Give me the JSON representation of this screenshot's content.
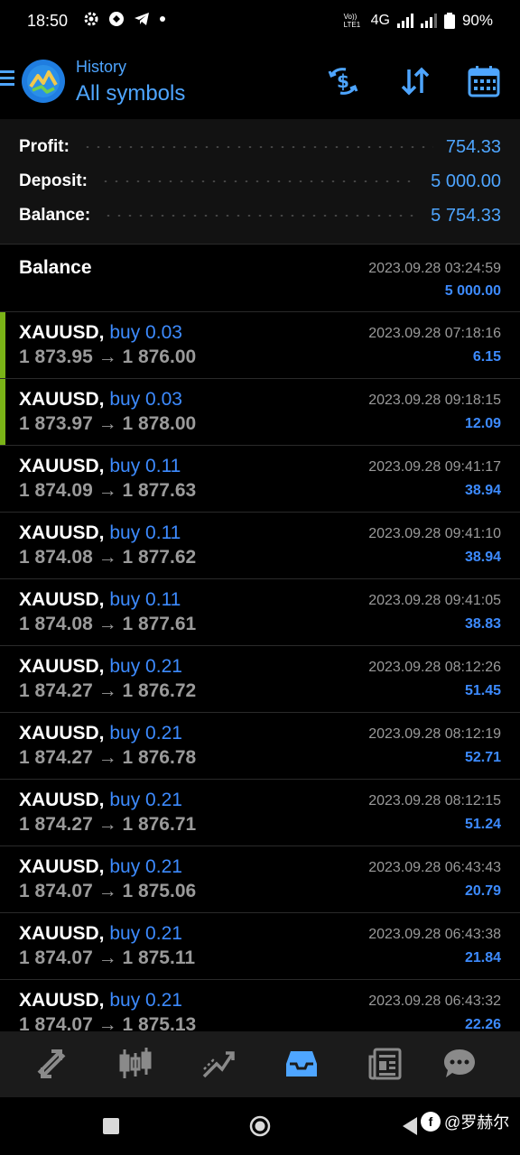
{
  "status_bar": {
    "time": "18:50",
    "network": "4G",
    "battery": "90%",
    "volte": "Vo)) LTE1"
  },
  "header": {
    "subtitle": "History",
    "title": "All symbols",
    "icons": [
      "menu-icon",
      "metatrader-logo",
      "currency-filter-icon",
      "sort-icon",
      "calendar-icon"
    ],
    "accent_color": "#4ea5ff"
  },
  "summary": {
    "profit_label": "Profit:",
    "profit_value": "754.33",
    "deposit_label": "Deposit:",
    "deposit_value": "5 000.00",
    "balance_label": "Balance:",
    "balance_value": "5 754.33"
  },
  "balance_entry": {
    "label": "Balance",
    "datetime": "2023.09.28 03:24:59",
    "amount": "5 000.00"
  },
  "trades": [
    {
      "symbol": "XAUUSD,",
      "side": "buy 0.03",
      "open": "1 873.95",
      "close": "1 876.00",
      "datetime": "2023.09.28 07:18:16",
      "profit": "6.15",
      "highlight": true
    },
    {
      "symbol": "XAUUSD,",
      "side": "buy 0.03",
      "open": "1 873.97",
      "close": "1 878.00",
      "datetime": "2023.09.28 09:18:15",
      "profit": "12.09",
      "highlight": true
    },
    {
      "symbol": "XAUUSD,",
      "side": "buy 0.11",
      "open": "1 874.09",
      "close": "1 877.63",
      "datetime": "2023.09.28 09:41:17",
      "profit": "38.94",
      "highlight": false
    },
    {
      "symbol": "XAUUSD,",
      "side": "buy 0.11",
      "open": "1 874.08",
      "close": "1 877.62",
      "datetime": "2023.09.28 09:41:10",
      "profit": "38.94",
      "highlight": false
    },
    {
      "symbol": "XAUUSD,",
      "side": "buy 0.11",
      "open": "1 874.08",
      "close": "1 877.61",
      "datetime": "2023.09.28 09:41:05",
      "profit": "38.83",
      "highlight": false
    },
    {
      "symbol": "XAUUSD,",
      "side": "buy 0.21",
      "open": "1 874.27",
      "close": "1 876.72",
      "datetime": "2023.09.28 08:12:26",
      "profit": "51.45",
      "highlight": false
    },
    {
      "symbol": "XAUUSD,",
      "side": "buy 0.21",
      "open": "1 874.27",
      "close": "1 876.78",
      "datetime": "2023.09.28 08:12:19",
      "profit": "52.71",
      "highlight": false
    },
    {
      "symbol": "XAUUSD,",
      "side": "buy 0.21",
      "open": "1 874.27",
      "close": "1 876.71",
      "datetime": "2023.09.28 08:12:15",
      "profit": "51.24",
      "highlight": false
    },
    {
      "symbol": "XAUUSD,",
      "side": "buy 0.21",
      "open": "1 874.07",
      "close": "1 875.06",
      "datetime": "2023.09.28 06:43:43",
      "profit": "20.79",
      "highlight": false
    },
    {
      "symbol": "XAUUSD,",
      "side": "buy 0.21",
      "open": "1 874.07",
      "close": "1 875.11",
      "datetime": "2023.09.28 06:43:38",
      "profit": "21.84",
      "highlight": false
    },
    {
      "symbol": "XAUUSD,",
      "side": "buy 0.21",
      "open": "1 874.07",
      "close": "1 875.13",
      "datetime": "2023.09.28 06:43:32",
      "profit": "22.26",
      "highlight": false
    }
  ],
  "arrow": "→",
  "tabbar": {
    "tabs": [
      {
        "icon": "quotes-icon",
        "active": false
      },
      {
        "icon": "chart-icon",
        "active": false
      },
      {
        "icon": "trade-icon",
        "active": false
      },
      {
        "icon": "history-icon",
        "active": true
      },
      {
        "icon": "news-icon",
        "active": false
      },
      {
        "icon": "chat-icon",
        "active": false
      }
    ],
    "active_color": "#4ea5ff",
    "inactive_color": "#9a9a9a"
  },
  "watermark": {
    "logo_text": "f",
    "text": "@罗赫尔"
  }
}
